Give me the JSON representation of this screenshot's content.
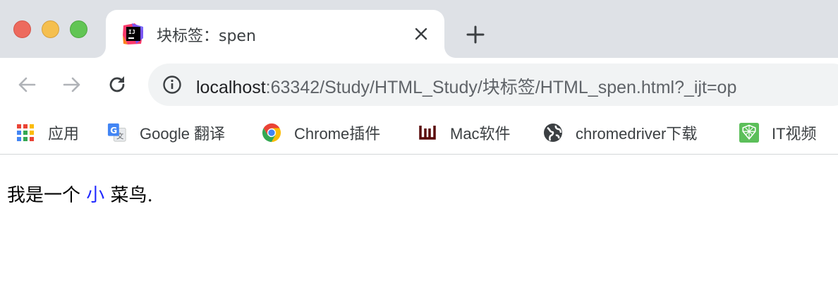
{
  "window": {
    "controls": [
      "close",
      "minimize",
      "zoom"
    ]
  },
  "tab": {
    "favicon": "intellij-icon",
    "title": "块标签：spen",
    "close_icon": "close-icon"
  },
  "new_tab_icon": "plus-icon",
  "toolbar": {
    "back_icon": "arrow-left-icon",
    "forward_icon": "arrow-right-icon",
    "reload_icon": "reload-icon",
    "info_icon": "info-icon",
    "url_host": "localhost",
    "url_rest": ":63342/Study/HTML_Study/块标签/HTML_spen.html?_ijt=op"
  },
  "bookmarks": [
    {
      "icon": "apps-grid-icon",
      "label": "应用"
    },
    {
      "icon": "google-translate-icon",
      "label": "Google 翻译"
    },
    {
      "icon": "chrome-icon",
      "label": "Chrome插件"
    },
    {
      "icon": "mac-software-icon",
      "label": "Mac软件"
    },
    {
      "icon": "globe-icon",
      "label": "chromedriver下载"
    },
    {
      "icon": "it-video-icon",
      "label": "IT视频"
    }
  ],
  "page": {
    "text_before": "我是一个 ",
    "text_highlight": "小",
    "text_after": " 菜鸟.",
    "highlight_color": "#1f28ff"
  }
}
